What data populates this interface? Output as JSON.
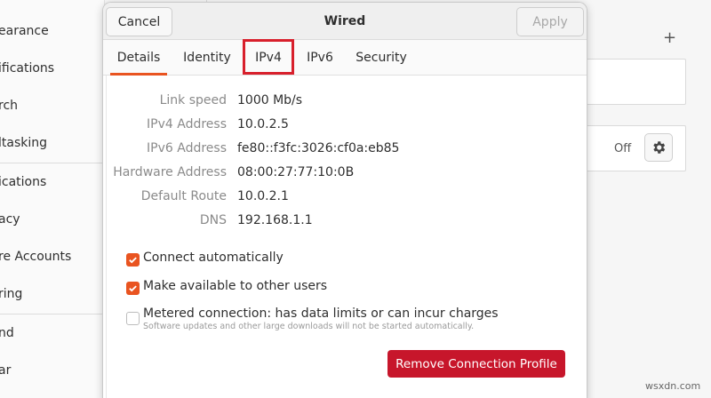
{
  "background": {
    "sidebar_items": [
      "earance",
      "ifications",
      "rch",
      "ltasking",
      "ications",
      "acy",
      "re Accounts",
      "ring",
      "nd",
      "ar"
    ],
    "plus_label": "+",
    "off_label": "Off"
  },
  "dialog": {
    "title": "Wired",
    "cancel_label": "Cancel",
    "apply_label": "Apply",
    "tabs": [
      {
        "label": "Details"
      },
      {
        "label": "Identity"
      },
      {
        "label": "IPv4"
      },
      {
        "label": "IPv6"
      },
      {
        "label": "Security"
      }
    ],
    "details": [
      {
        "label": "Link speed",
        "value": "1000 Mb/s"
      },
      {
        "label": "IPv4 Address",
        "value": "10.0.2.5"
      },
      {
        "label": "IPv6 Address",
        "value": "fe80::f3fc:3026:cf0a:eb85"
      },
      {
        "label": "Hardware Address",
        "value": "08:00:27:77:10:0B"
      },
      {
        "label": "Default Route",
        "value": "10.0.2.1"
      },
      {
        "label": "DNS",
        "value": "192.168.1.1"
      }
    ],
    "options": [
      {
        "label": "Connect automatically",
        "checked": true
      },
      {
        "label": "Make available to other users",
        "checked": true
      },
      {
        "label": "Metered connection: has data limits or can incur charges",
        "checked": false,
        "sublabel": "Software updates and other large downloads will not be started automatically."
      }
    ],
    "remove_label": "Remove Connection Profile"
  },
  "watermark": "wsxdn.com",
  "colors": {
    "accent": "#e95420",
    "danger": "#c7162b",
    "highlight": "#d8202c"
  }
}
